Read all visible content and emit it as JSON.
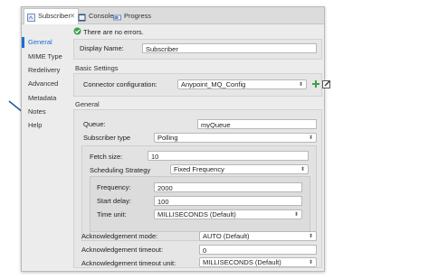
{
  "tabs": {
    "subscriber": "Subscriber",
    "console": "Console",
    "progress": "Progress"
  },
  "status": {
    "message": "There are no errors."
  },
  "nav": {
    "items": [
      "General",
      "MIME Type",
      "Redelivery",
      "Advanced",
      "Metadata",
      "Notes",
      "Help"
    ]
  },
  "form": {
    "display_name_label": "Display Name:",
    "display_name_value": "Subscriber",
    "basic_settings_title": "Basic Settings",
    "connector_config_label": "Connector configuration:",
    "connector_config_value": "Anypoint_MQ_Config",
    "general_title": "General",
    "queue_label": "Queue:",
    "queue_value": "myQueue",
    "subscriber_type_label": "Subscriber type",
    "subscriber_type_value": "Polling",
    "fetch_size_label": "Fetch size:",
    "fetch_size_value": "10",
    "scheduling_strategy_label": "Scheduling Strategy",
    "scheduling_strategy_value": "Fixed Frequency",
    "frequency_label": "Frequency:",
    "frequency_value": "2000",
    "start_delay_label": "Start delay:",
    "start_delay_value": "100",
    "time_unit_label": "Time unit:",
    "time_unit_value": "MILLISECONDS (Default)",
    "ack_mode_label": "Acknowledgement mode:",
    "ack_mode_value": "AUTO (Default)",
    "ack_timeout_label": "Acknowledgement timeout:",
    "ack_timeout_value": "0",
    "ack_timeout_unit_label": "Acknowledgement timeout unit:",
    "ack_timeout_unit_value": "MILLISECONDS (Default)"
  },
  "icons": {
    "status": "check-circle-icon",
    "add": "plus-icon",
    "edit": "edit-icon"
  },
  "colors": {
    "accent": "#1a6fd6",
    "ok_green": "#3aa24a",
    "arrow": "#1f5fa0"
  }
}
